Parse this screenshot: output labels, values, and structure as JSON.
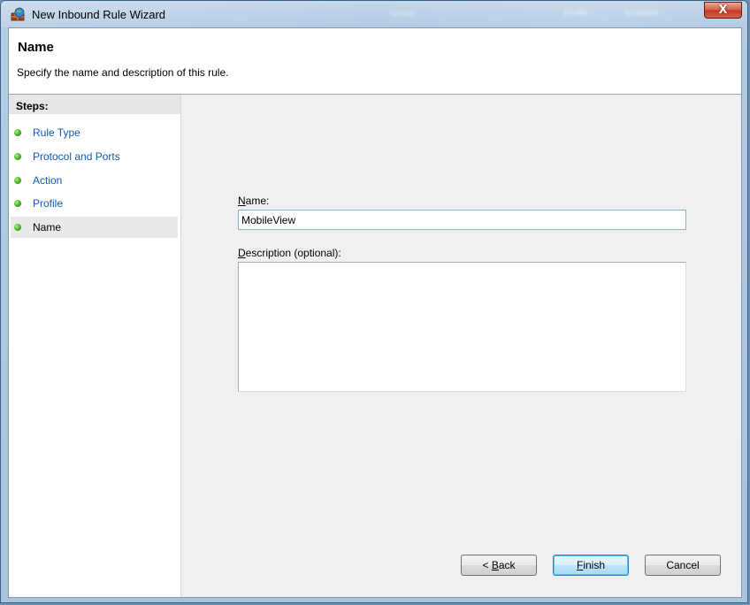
{
  "window": {
    "title": "New Inbound Rule Wizard",
    "close_glyph": "X",
    "background_ghost_text": [
      "Group",
      "Profile",
      "Enabled"
    ]
  },
  "header": {
    "title": "Name",
    "subtitle": "Specify the name and description of this rule."
  },
  "steps": {
    "title": "Steps:",
    "items": [
      {
        "label": "Rule Type",
        "current": false
      },
      {
        "label": "Protocol and Ports",
        "current": false
      },
      {
        "label": "Action",
        "current": false
      },
      {
        "label": "Profile",
        "current": false
      },
      {
        "label": "Name",
        "current": true
      }
    ]
  },
  "form": {
    "name_label_accel": "N",
    "name_label_rest": "ame:",
    "name_value": "MobileView",
    "description_label_accel": "D",
    "description_label_rest": "escription (optional):",
    "description_value": ""
  },
  "buttons": {
    "back_prefix": "< ",
    "back_accel": "B",
    "back_rest": "ack",
    "finish_accel": "F",
    "finish_rest": "inish",
    "cancel": "Cancel"
  },
  "colors": {
    "link": "#0b5bb5",
    "step_bullet": "#4fbb2b",
    "close_button": "#c2391f"
  }
}
